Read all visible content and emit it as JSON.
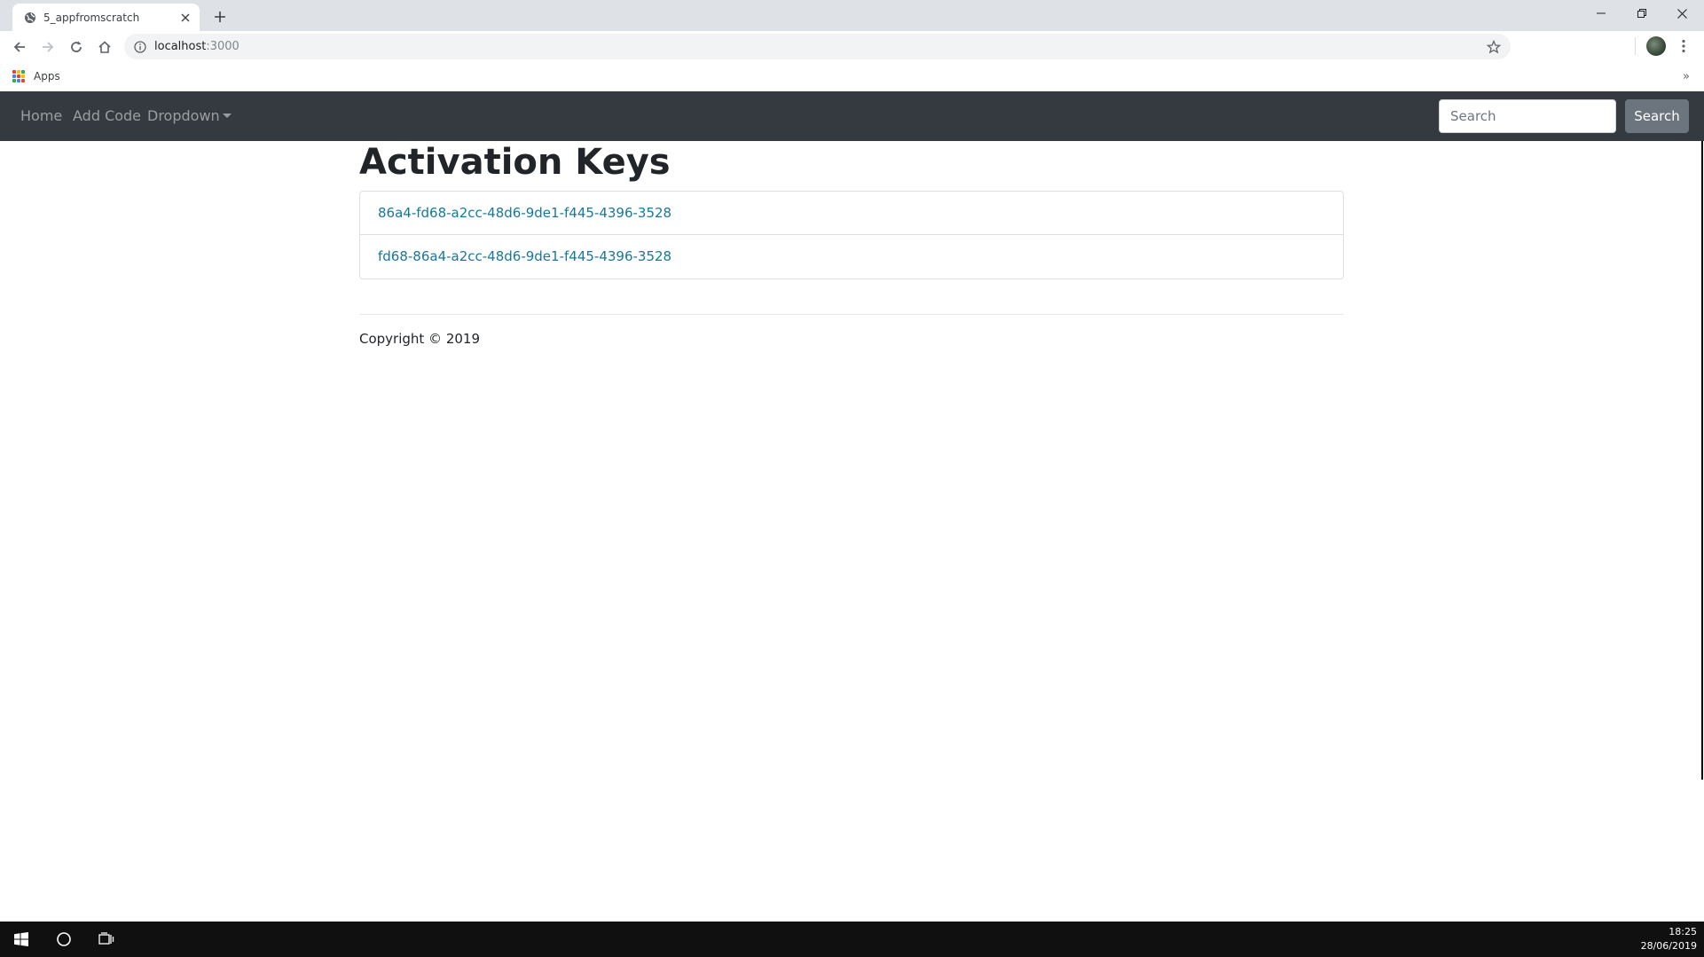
{
  "browser": {
    "tab_title": "5_appfromscratch",
    "url_host": "localhost",
    "url_port": ":3000",
    "bookmarks_apps_label": "Apps",
    "bookmarks_overflow": "»"
  },
  "navbar": {
    "links": [
      "Home",
      "Add Code",
      "Dropdown"
    ],
    "search_placeholder": "Search",
    "search_button": "Search"
  },
  "main": {
    "title": "Activation Keys",
    "keys": [
      "86a4-fd68-a2cc-48d6-9de1-f445-4396-3528",
      "fd68-86a4-a2cc-48d6-9de1-f445-4396-3528"
    ],
    "footer": "Copyright © 2019"
  },
  "taskbar": {
    "time": "18:25",
    "date": "28/06/2019"
  },
  "colors": {
    "navbar_bg": "#343a40",
    "link": "#17789a",
    "search_button_bg": "#6c757d"
  }
}
